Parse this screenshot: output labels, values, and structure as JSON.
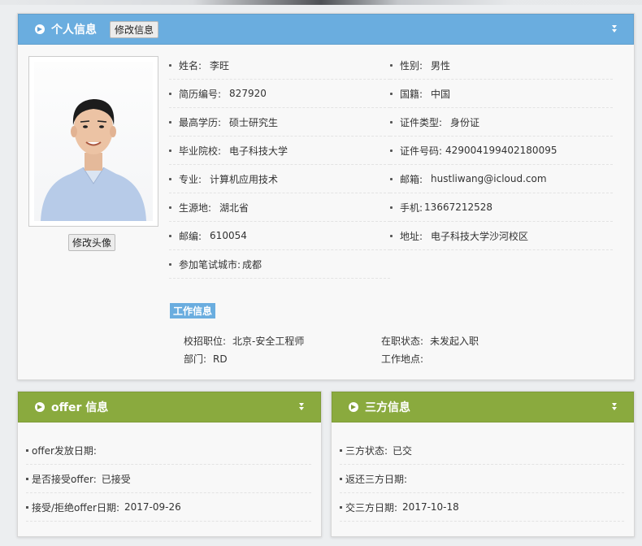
{
  "personal": {
    "title": "个人信息",
    "edit_button": "修改信息",
    "avatar_button": "修改头像",
    "left_fields": [
      {
        "label": "姓名:",
        "value": "李旺"
      },
      {
        "label": "简历编号:",
        "value": "827920"
      },
      {
        "label": "最高学历:",
        "value": "硕士研究生"
      },
      {
        "label": "毕业院校:",
        "value": "电子科技大学"
      },
      {
        "label": "专业:",
        "value": "计算机应用技术"
      },
      {
        "label": "生源地:",
        "value": "湖北省"
      },
      {
        "label": "邮编:",
        "value": "610054"
      },
      {
        "label": "参加笔试城市:",
        "value": "成都"
      }
    ],
    "right_fields": [
      {
        "label": "性别:",
        "value": "男性"
      },
      {
        "label": "国籍:",
        "value": "中国"
      },
      {
        "label": "证件类型:",
        "value": "身份证"
      },
      {
        "label": "证件号码:",
        "value": "429004199402180095"
      },
      {
        "label": "邮箱:",
        "value": "hustliwang@icloud.com"
      },
      {
        "label": "手机:",
        "value": "13667212528"
      },
      {
        "label": "地址:",
        "value": "电子科技大学沙河校区"
      }
    ]
  },
  "work": {
    "title": "工作信息",
    "fields": [
      {
        "label": "校招职位:",
        "value": "北京-安全工程师"
      },
      {
        "label": "在职状态:",
        "value": "未发起入职"
      },
      {
        "label": "部门:",
        "value": "RD"
      },
      {
        "label": "工作地点:",
        "value": ""
      }
    ]
  },
  "offer": {
    "title": "offer 信息",
    "fields": [
      {
        "label": "offer发放日期:",
        "value": ""
      },
      {
        "label": "是否接受offer:",
        "value": "已接受"
      },
      {
        "label": "接受/拒绝offer日期:",
        "value": "2017-09-26"
      }
    ]
  },
  "tripartite": {
    "title": "三方信息",
    "fields": [
      {
        "label": "三方状态:",
        "value": "已交"
      },
      {
        "label": "返还三方日期:",
        "value": ""
      },
      {
        "label": "交三方日期:",
        "value": "2017-10-18"
      }
    ]
  },
  "colors": {
    "blue_header": "#6aaddf",
    "green_header": "#8aaa3e"
  }
}
